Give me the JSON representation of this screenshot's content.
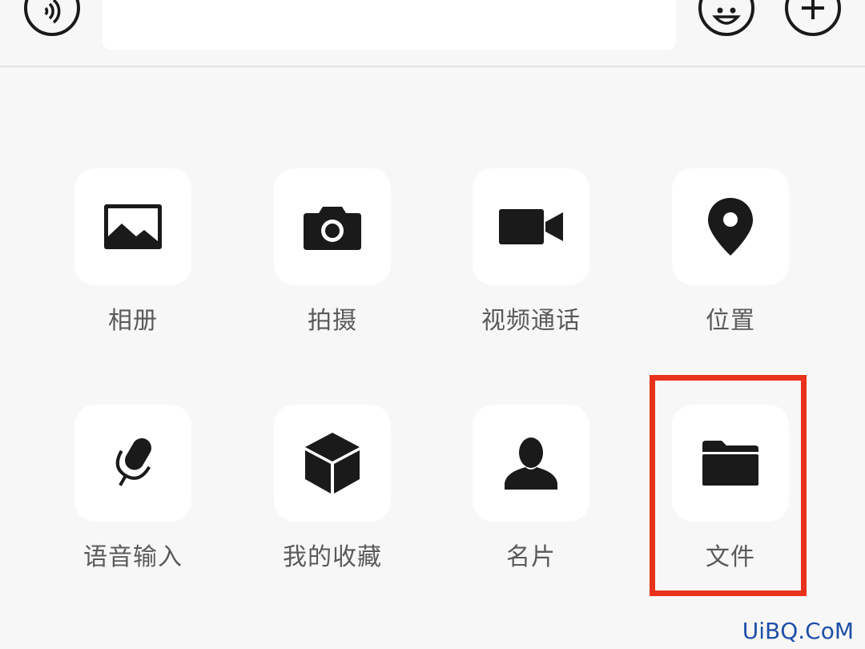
{
  "input_bar": {
    "voice_icon": "voice-wave-icon",
    "emoji_icon": "smiley-face-icon",
    "plus_icon": "plus-icon",
    "text_value": ""
  },
  "tiles": [
    {
      "label": "相册",
      "icon": "photo-album-icon"
    },
    {
      "label": "拍摄",
      "icon": "camera-icon"
    },
    {
      "label": "视频通话",
      "icon": "video-call-icon"
    },
    {
      "label": "位置",
      "icon": "location-pin-icon"
    },
    {
      "label": "语音输入",
      "icon": "microphone-icon"
    },
    {
      "label": "我的收藏",
      "icon": "cube-icon"
    },
    {
      "label": "名片",
      "icon": "contact-card-icon"
    },
    {
      "label": "文件",
      "icon": "folder-icon"
    }
  ],
  "highlight": {
    "target": "文件",
    "color": "#e8321c"
  },
  "watermark": "UiBQ.CoM"
}
